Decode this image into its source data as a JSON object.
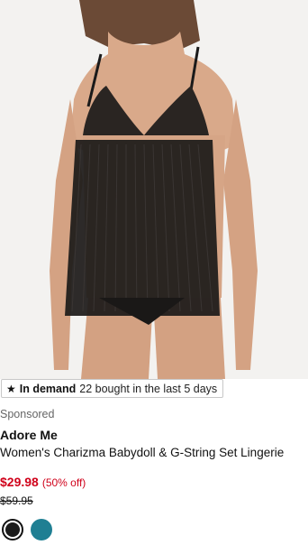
{
  "product": {
    "badge": {
      "star_icon": "star-icon",
      "label": "In demand",
      "text": "22 bought in the last 5 days"
    },
    "sponsored_label": "Sponsored",
    "brand": "Adore Me",
    "title": "Women's Charizma Babydoll & G-String Set Lingerie",
    "price": {
      "sale": "$29.98",
      "discount": "(50% off)",
      "original": "$59.95",
      "sale_color": "#d0021b"
    },
    "swatches": [
      {
        "name": "black",
        "color": "#1b1b1b",
        "selected": true
      },
      {
        "name": "teal",
        "color": "#1f7f93",
        "selected": false
      }
    ]
  }
}
